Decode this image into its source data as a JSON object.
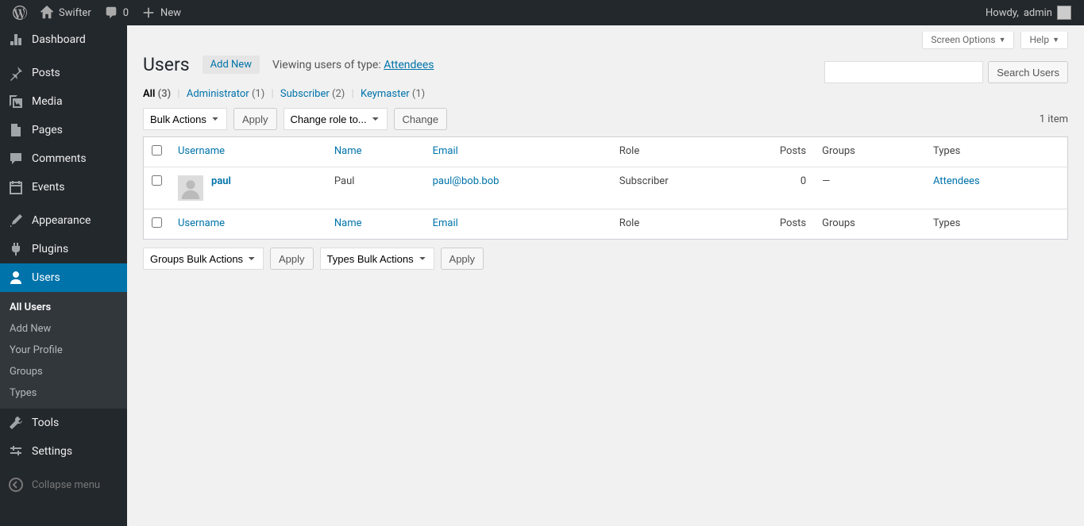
{
  "adminbar": {
    "site_name": "Swifter",
    "comment_count": "0",
    "new_label": "New",
    "howdy_prefix": "Howdy, ",
    "user_name": "admin"
  },
  "sidebar": {
    "items": [
      {
        "label": "Dashboard",
        "icon": "dashboard"
      },
      {
        "label": "Posts",
        "icon": "pin"
      },
      {
        "label": "Media",
        "icon": "media"
      },
      {
        "label": "Pages",
        "icon": "pages"
      },
      {
        "label": "Comments",
        "icon": "comment"
      },
      {
        "label": "Events",
        "icon": "calendar"
      },
      {
        "label": "Appearance",
        "icon": "brush"
      },
      {
        "label": "Plugins",
        "icon": "plug"
      },
      {
        "label": "Users",
        "icon": "user",
        "current": true
      },
      {
        "label": "Tools",
        "icon": "wrench"
      },
      {
        "label": "Settings",
        "icon": "sliders"
      }
    ],
    "submenu": [
      {
        "label": "All Users",
        "current": true
      },
      {
        "label": "Add New"
      },
      {
        "label": "Your Profile"
      },
      {
        "label": "Groups"
      },
      {
        "label": "Types"
      }
    ],
    "collapse_label": "Collapse menu"
  },
  "screen_meta": {
    "screen_options": "Screen Options",
    "help": "Help"
  },
  "page": {
    "title": "Users",
    "add_new": "Add New",
    "viewing_prefix": "Viewing users of type: ",
    "viewing_type": "Attendees"
  },
  "filters": {
    "all_label": "All",
    "all_count": "(3)",
    "admin_label": "Administrator",
    "admin_count": "(1)",
    "subscriber_label": "Subscriber",
    "subscriber_count": "(2)",
    "keymaster_label": "Keymaster",
    "keymaster_count": "(1)"
  },
  "search": {
    "button": "Search Users"
  },
  "bulk": {
    "bulk_actions": "Bulk Actions",
    "apply": "Apply",
    "change_role": "Change role to...",
    "change": "Change",
    "groups_bulk": "Groups Bulk Actions",
    "types_bulk": "Types Bulk Actions"
  },
  "item_count": "1 item",
  "columns": {
    "username": "Username",
    "name": "Name",
    "email": "Email",
    "role": "Role",
    "posts": "Posts",
    "groups": "Groups",
    "types": "Types"
  },
  "rows": [
    {
      "username": "paul",
      "name": "Paul",
      "email": "paul@bob.bob",
      "role": "Subscriber",
      "posts": "0",
      "groups": "—",
      "types": "Attendees"
    }
  ]
}
